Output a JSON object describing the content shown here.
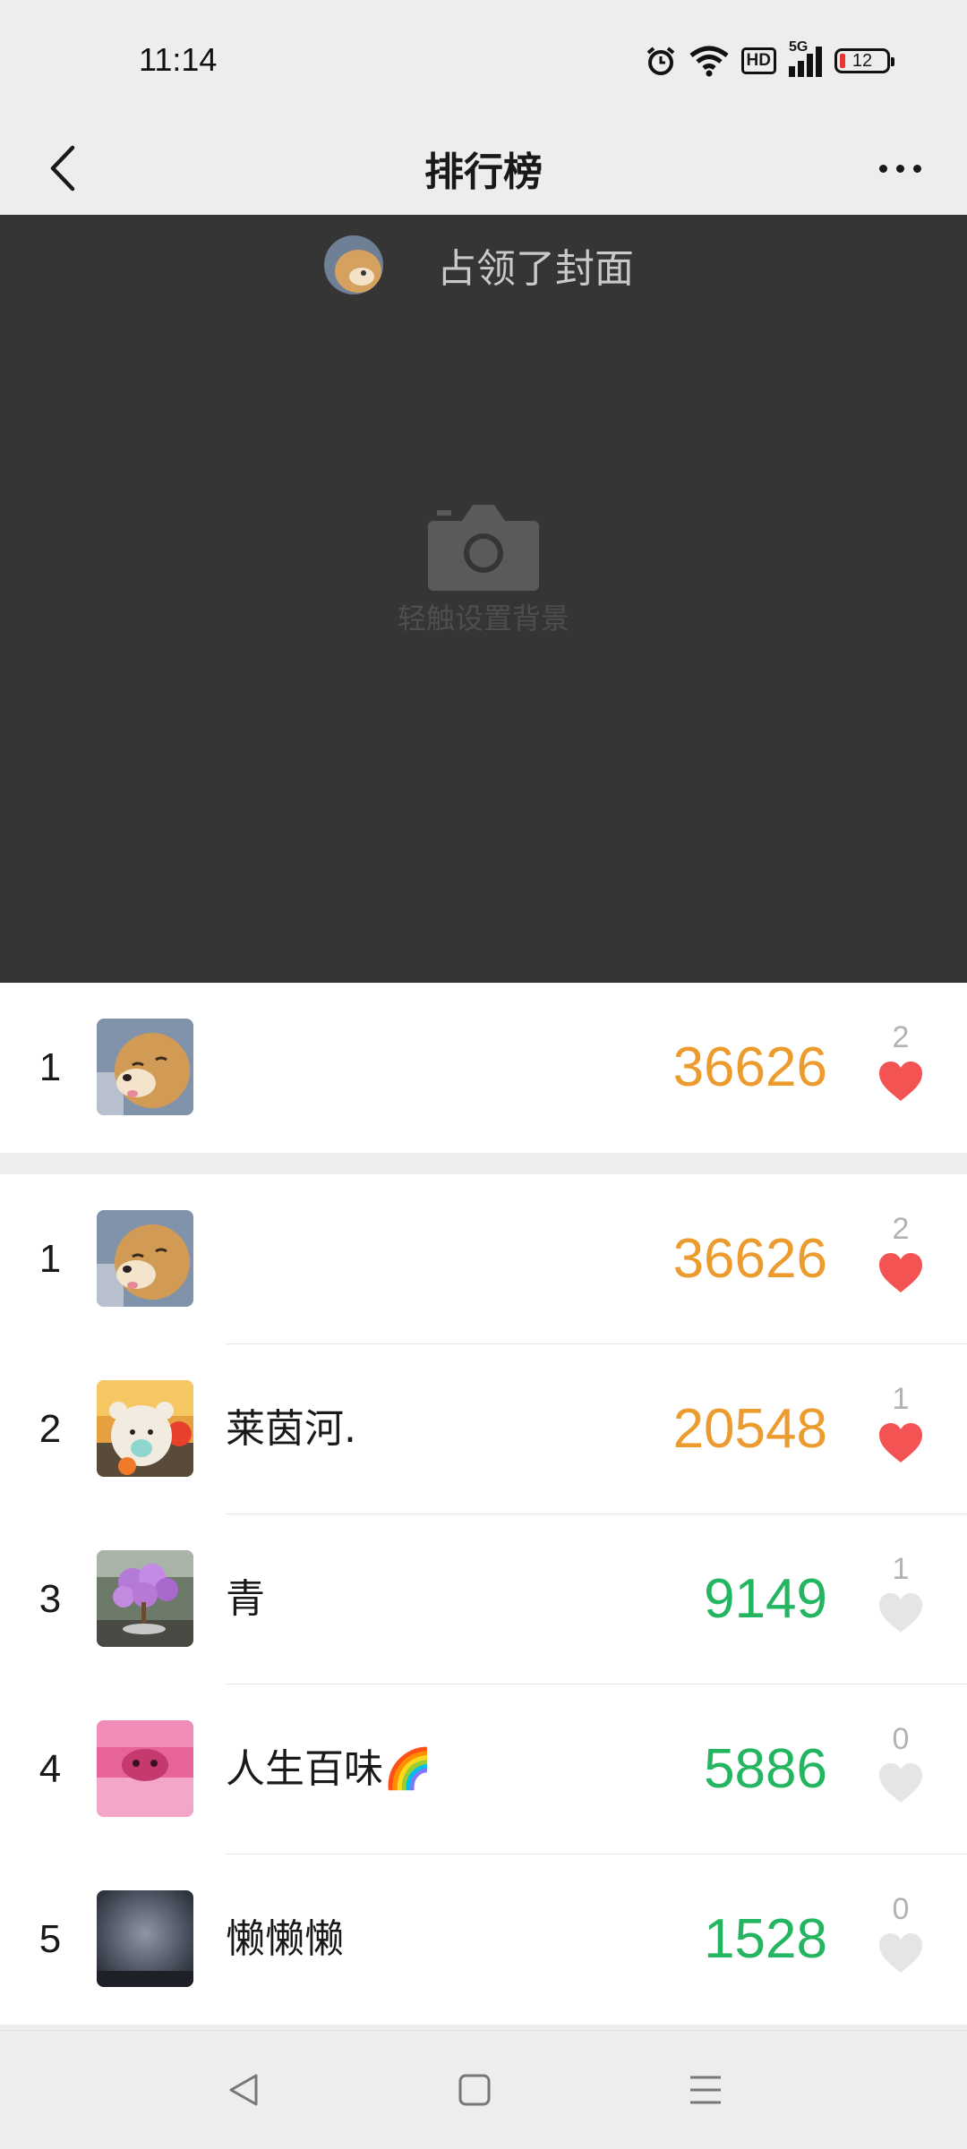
{
  "status_bar": {
    "time": "11:14",
    "network": "5G",
    "hd": "HD",
    "battery": "12"
  },
  "nav": {
    "title": "排行榜"
  },
  "cover": {
    "owner_text": "占领了封面",
    "set_background_text": "轻触设置背景"
  },
  "my_row": {
    "rank": "1",
    "name": "",
    "steps": "36626",
    "likes": "2",
    "liked": true,
    "steps_color": "orange"
  },
  "ranking": [
    {
      "rank": "1",
      "name": "",
      "steps": "36626",
      "likes": "2",
      "liked": true,
      "steps_color": "orange"
    },
    {
      "rank": "2",
      "name": "莱茵河.",
      "steps": "20548",
      "likes": "1",
      "liked": true,
      "steps_color": "orange"
    },
    {
      "rank": "3",
      "name": "青",
      "steps": "9149",
      "likes": "1",
      "liked": false,
      "steps_color": "green"
    },
    {
      "rank": "4",
      "name": "人生百味🌈",
      "steps": "5886",
      "likes": "0",
      "liked": false,
      "steps_color": "green"
    },
    {
      "rank": "5",
      "name": "懒懒懒",
      "steps": "1528",
      "likes": "0",
      "liked": false,
      "steps_color": "green"
    }
  ],
  "colors": {
    "steps_high": "#ec9b2e",
    "steps_low": "#23b560",
    "heart_liked": "#f35353",
    "heart_unliked": "#e5e5e5"
  },
  "icons": [
    "alarm-icon",
    "wifi-icon",
    "signal-icon",
    "battery-icon",
    "back-icon",
    "more-icon",
    "camera-icon",
    "heart-icon",
    "nav-back-icon",
    "nav-home-icon",
    "nav-menu-icon"
  ]
}
